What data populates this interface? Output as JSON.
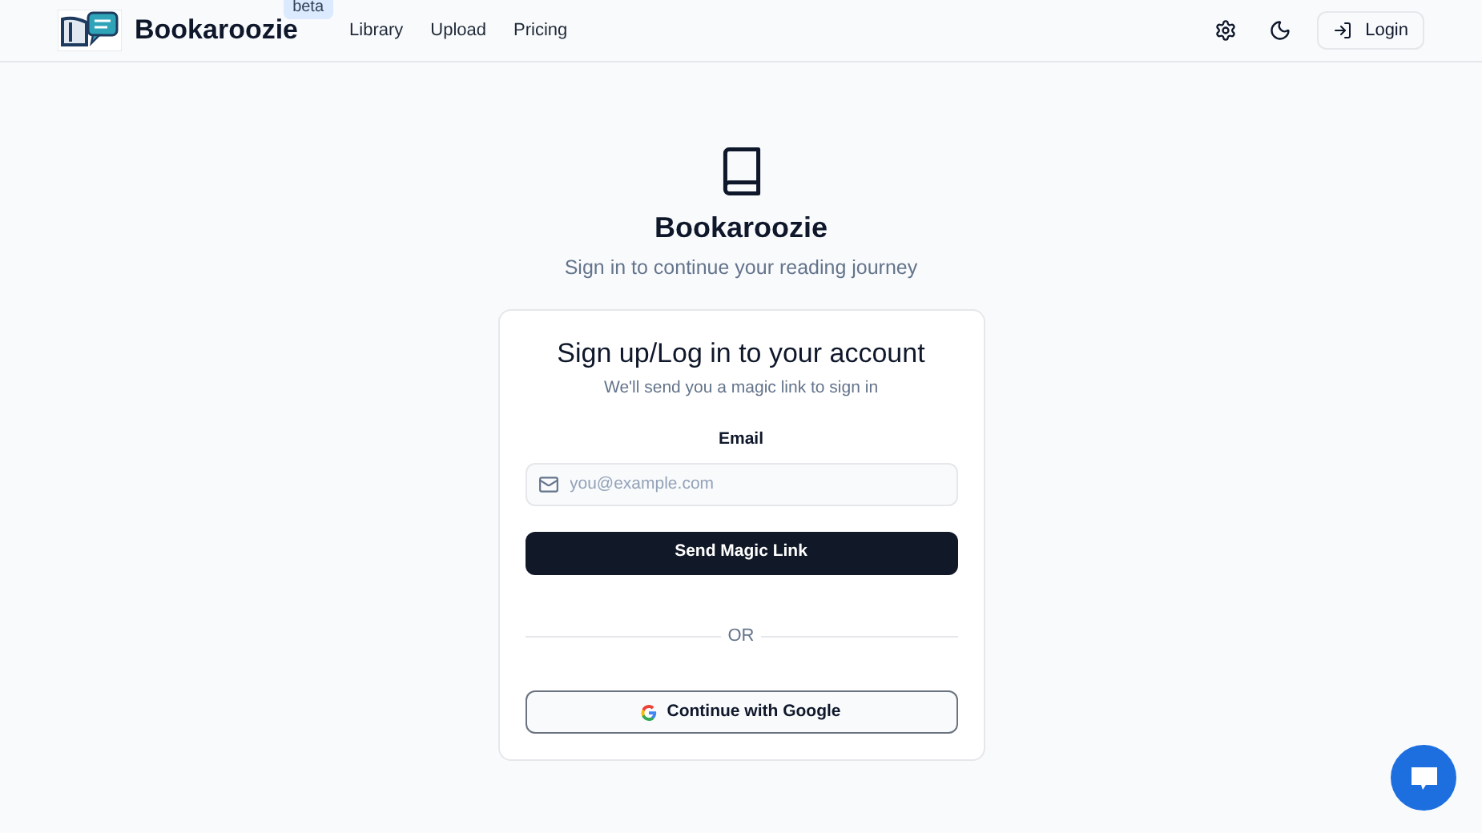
{
  "header": {
    "brand": "Bookaroozie",
    "badge": "beta",
    "nav": [
      {
        "label": "Library"
      },
      {
        "label": "Upload"
      },
      {
        "label": "Pricing"
      }
    ],
    "login": "Login"
  },
  "hero": {
    "title": "Bookaroozie",
    "subtitle": "Sign in to continue your reading journey"
  },
  "card": {
    "title": "Sign up/Log in to your account",
    "subtitle": "We'll send you a magic link to sign in",
    "email_label": "Email",
    "email_placeholder": "you@example.com",
    "submit": "Send Magic Link",
    "divider": "OR",
    "google": "Continue with Google"
  }
}
